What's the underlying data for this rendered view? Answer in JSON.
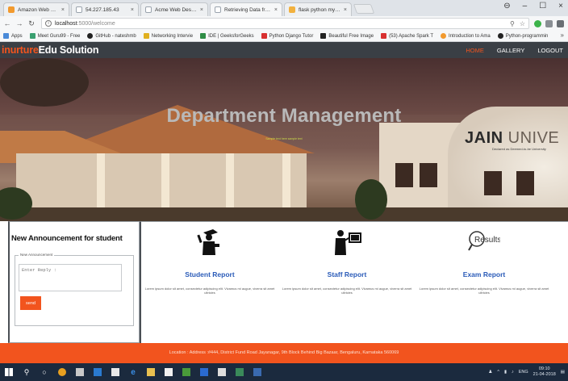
{
  "browser": {
    "tabs": [
      {
        "label": "Amazon Web Services Si",
        "color": "#f29a2e"
      },
      {
        "label": "54.227.185.43",
        "color": "#9aa3ad"
      },
      {
        "label": "Acme Web Design | Wel",
        "color": "#9aa3ad"
      },
      {
        "label": "Retrieving Data from My",
        "color": "#9aa3ad"
      },
      {
        "label": "flask python mysql - Se",
        "color": "#f2b13e"
      }
    ],
    "address": {
      "host": "localhost",
      "path": ":5000/welcome"
    },
    "bookmarks": [
      {
        "label": "Apps",
        "color": "#4a8ad8"
      },
      {
        "label": "Meet Guru99 - Free",
        "color": "#3aa070"
      },
      {
        "label": "GitHub - nateshmb",
        "color": "#222222"
      },
      {
        "label": "Networking Intervie",
        "color": "#e0b020"
      },
      {
        "label": "IDE | GeeksforGeeks",
        "color": "#2f8d46"
      },
      {
        "label": "Python Django Tutor",
        "color": "#d83030"
      },
      {
        "label": "Beautiful Free Image",
        "color": "#222222"
      },
      {
        "label": "(53) Apache Spark T",
        "color": "#d83030"
      },
      {
        "label": "Introduction to Ama",
        "color": "#f29a2e"
      },
      {
        "label": "Python-programmin",
        "color": "#222222"
      }
    ]
  },
  "site": {
    "brand_part1": "inurture",
    "brand_part2": "Edu Solution",
    "nav": [
      {
        "label": "HOME",
        "active": true
      },
      {
        "label": "GALLERY",
        "active": false
      },
      {
        "label": "LOGOUT",
        "active": false
      }
    ]
  },
  "hero": {
    "title": "Department Management",
    "subtitle": "Sample text here sample text",
    "banner_word1": "JAIN",
    "banner_word2": "UNIVE",
    "banner_sub": "Declared as Deemed-to-be University"
  },
  "announcement": {
    "heading": "New Announcement for student",
    "legend": "New Announcement",
    "placeholder": "Enter Reply :",
    "send_label": "send"
  },
  "reports": [
    {
      "title": "Student Report",
      "icon": "graduate-icon",
      "desc": "Lorem ipsum dolor sit amet, consectetur adipiscing elit. Vivamus mi augue, viverra sit amet ultricies"
    },
    {
      "title": "Staff Report",
      "icon": "teacher-board-icon",
      "desc": "Lorem ipsum dolor sit amet, consectetur adipiscing elit. Vivamus mi augue, viverra sit amet ultricies"
    },
    {
      "title": "Exam Report",
      "icon": "results-magnifier-icon",
      "icon_text": "Results",
      "desc": "Lorem ipsum dolor sit amet, consectetur adipiscing elit. Vivamus mi augue, viverra sit amet ultricies"
    }
  ],
  "footer": {
    "text": "Location : Address :#444, District Fund Road Jayanagar, 9th Block Behind Big Bazaar, Bengaluru, Karnataka 560069"
  },
  "taskbar": {
    "lang": "ENG",
    "time": "09:10",
    "date": "21-04-2018"
  },
  "colors": {
    "accent": "#f2541e",
    "nav_bg": "#3a3f45",
    "link_blue": "#2a5bb8"
  }
}
